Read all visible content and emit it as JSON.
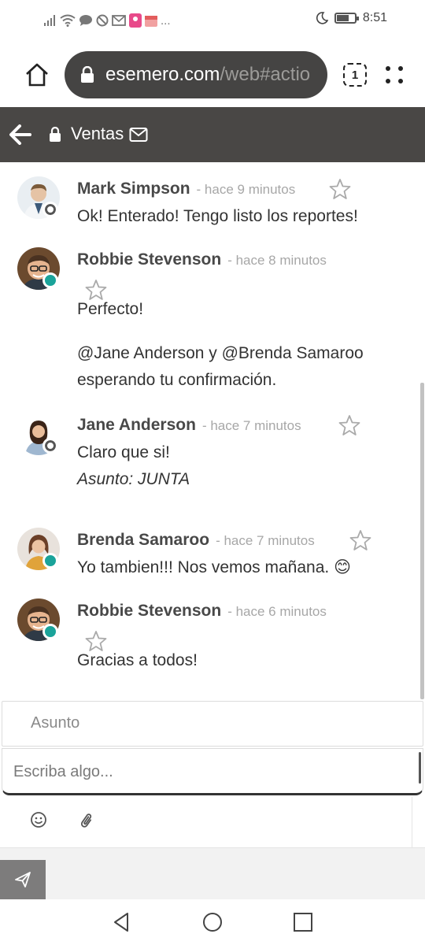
{
  "status_bar": {
    "left_icons": [
      "signal-icon",
      "wifi-icon",
      "chat-icon",
      "block-icon",
      "mail-icon",
      "location-icon",
      "calendar-icon"
    ],
    "more": "...",
    "time": "8:51",
    "battery_level": 0.7
  },
  "browser": {
    "url_host": "esemero.com",
    "url_path": "/web#actio",
    "tab_count": "1"
  },
  "header": {
    "title": "Ventas"
  },
  "messages": [
    {
      "author": "Mark Simpson",
      "time": "- hace 9 minutos",
      "status": "offline",
      "lines": [
        "Ok! Enterado! Tengo listo los reportes!"
      ]
    },
    {
      "author": "Robbie Stevenson",
      "time": "- hace 8 minutos",
      "status": "online",
      "lines": [
        "Perfecto!",
        "@Jane Anderson y @Brenda Samaroo",
        "esperando tu confirmación."
      ]
    },
    {
      "author": "Jane Anderson",
      "time": "- hace 7 minutos",
      "status": "offline",
      "lines": [
        "Claro que si!",
        "Asunto: JUNTA"
      ]
    },
    {
      "author": "Brenda Samaroo",
      "time": "- hace 7 minutos",
      "status": "online",
      "lines": [
        "Yo tambien!!! Nos vemos mañana. 😊"
      ]
    },
    {
      "author": "Robbie Stevenson",
      "time": "- hace 6 minutos",
      "status": "online",
      "lines": [
        "Gracias a todos!"
      ]
    }
  ],
  "composer": {
    "subject_placeholder": "Asunto",
    "message_placeholder": "Escriba algo..."
  },
  "colors": {
    "header_bg": "#494745",
    "url_bg": "#454443",
    "online": "#1aa39a"
  }
}
